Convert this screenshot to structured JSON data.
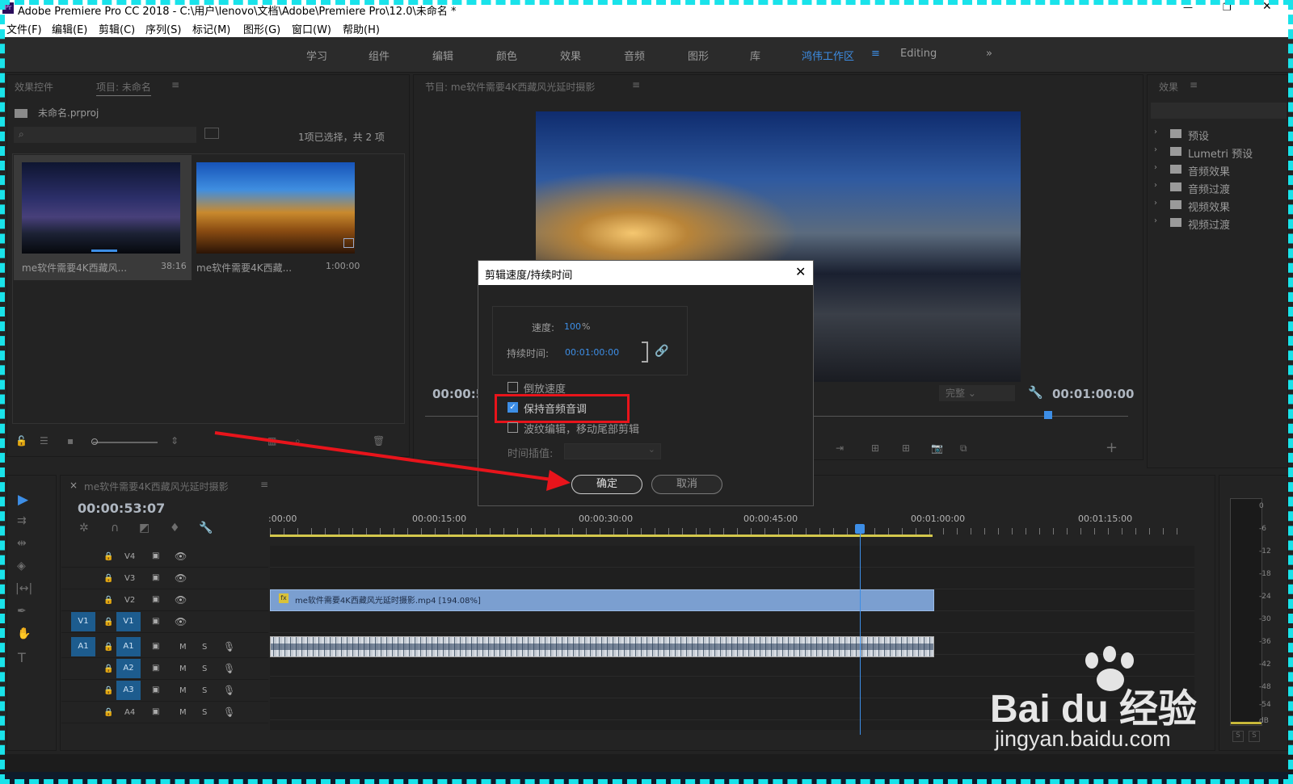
{
  "titlebar": {
    "title": "Adobe Premiere Pro CC 2018 - C:\\用户\\lenovo\\文档\\Adobe\\Premiere Pro\\12.0\\未命名 *"
  },
  "menu": [
    "文件(F)",
    "编辑(E)",
    "剪辑(C)",
    "序列(S)",
    "标记(M)",
    "图形(G)",
    "窗口(W)",
    "帮助(H)"
  ],
  "workspaces": [
    "学习",
    "组件",
    "编辑",
    "颜色",
    "效果",
    "音频",
    "图形",
    "库",
    "鸿伟工作区",
    "Editing"
  ],
  "workspace_active": "鸿伟工作区",
  "project_panel": {
    "tab_effects_controls": "效果控件",
    "tab_project": "项目: 未命名",
    "project_file": "未命名.prproj",
    "selection_info": "1项已选择，共 2 项",
    "items": [
      {
        "name": "me软件需要4K西藏风...",
        "duration": "38:16"
      },
      {
        "name": "me软件需要4K西藏...",
        "duration": "1:00:00"
      }
    ]
  },
  "program_monitor": {
    "title": "节目: me软件需要4K西藏风光延时摄影",
    "timecode_current": "00:00:53",
    "timecode_end": "00:01:00:00",
    "resolution": "完整"
  },
  "effects_panel": {
    "title": "效果",
    "items": [
      "预设",
      "Lumetri 预设",
      "音频效果",
      "音频过渡",
      "视频效果",
      "视频过渡"
    ]
  },
  "dialog": {
    "title": "剪辑速度/持续时间",
    "speed_label": "速度:",
    "speed_value": "100",
    "speed_unit": "%",
    "duration_label": "持续时间:",
    "duration_value": "00:01:00:00",
    "reverse_label": "倒放速度",
    "reverse_checked": false,
    "maintain_pitch_label": "保持音频音调",
    "maintain_pitch_checked": true,
    "ripple_label": "波纹编辑，移动尾部剪辑",
    "ripple_checked": false,
    "interp_label": "时间插值:",
    "ok_label": "确定",
    "cancel_label": "取消"
  },
  "timeline": {
    "sequence_name": "me软件需要4K西藏风光延时摄影",
    "timecode": "00:00:53:07",
    "ruler": [
      ":00:00",
      "00:00:15:00",
      "00:00:30:00",
      "00:00:45:00",
      "00:01:00:00",
      "00:01:15:00"
    ],
    "video_tracks": [
      "V4",
      "V3",
      "V2",
      "V1"
    ],
    "audio_tracks": [
      "A1",
      "A2",
      "A3",
      "A4"
    ],
    "source_v": "V1",
    "source_a": "A1",
    "clip_label": "me软件需要4K西藏风光延时摄影.mp4 [194.08%]",
    "track_m": "M",
    "track_s": "S"
  },
  "audio_meter": {
    "ticks": [
      "0",
      "-6",
      "-12",
      "-18",
      "-24",
      "-30",
      "-36",
      "-42",
      "-48",
      "-54",
      "dB"
    ],
    "solo": [
      "S",
      "S"
    ]
  },
  "watermark": {
    "brand": "Bai du 经验",
    "url": "jingyan.baidu.com"
  },
  "colors": {
    "accent": "#3d8ee6",
    "annotation": "#e8141b",
    "clip_video": "#7b9fd0",
    "frame": "#19e3ea"
  }
}
